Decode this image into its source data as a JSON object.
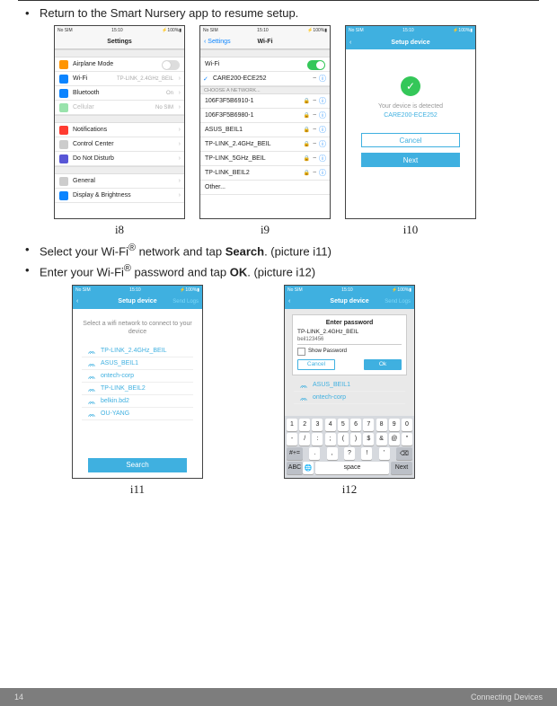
{
  "bullets": {
    "b1": "Return to the Smart Nursery app to resume setup.",
    "b2_pre": "Select your Wi-Fi",
    "b2_mid": " network and tap ",
    "b2_bold": "Search",
    "b2_post": ". (picture i11)",
    "b3_pre": "Enter your Wi-Fi",
    "b3_mid": " password and tap ",
    "b3_bold": "OK",
    "b3_post": ". (picture i12)",
    "reg": "®"
  },
  "captions": {
    "i8": "i8",
    "i9": "i9",
    "i10": "i10",
    "i11": "i11",
    "i12": "i12"
  },
  "status": {
    "left": "No SIM",
    "time": "15:10",
    "batt": "100%"
  },
  "i8": {
    "title": "Settings",
    "rows": {
      "airplane": "Airplane Mode",
      "wifi": "Wi-Fi",
      "wifi_val": "TP-LINK_2.4GHz_BEIL",
      "bt": "Bluetooth",
      "bt_val": "On",
      "cell": "Cellular",
      "cell_val": "No SIM",
      "notif": "Notifications",
      "cc": "Control Center",
      "dnd": "Do Not Disturb",
      "gen": "General",
      "disp": "Display & Brightness"
    }
  },
  "i9": {
    "back": "Settings",
    "title": "Wi-Fi",
    "wifi_label": "Wi-Fi",
    "connected": "CARE200-ECE252",
    "choose": "CHOOSE A NETWORK...",
    "n1": "106F3F5B6910-1",
    "n2": "106F3F5B6980-1",
    "n3": "ASUS_BEIL1",
    "n4": "TP-LINK_2.4GHz_BEIL",
    "n5": "TP-LINK_5GHz_BEIL",
    "n6": "TP-LINK_BEIL2",
    "other": "Other..."
  },
  "i10": {
    "title": "Setup device",
    "detected": "Your device is detected",
    "device": "CARE200-ECE252",
    "cancel": "Cancel",
    "next": "Next"
  },
  "i11": {
    "title": "Setup device",
    "send": "Send Logs",
    "prompt": "Select a wifi network to connect to your device",
    "n1": "TP-LINK_2.4GHz_BEIL",
    "n2": "ASUS_BEIL1",
    "n3": "ontech-corp",
    "n4": "TP-LINK_BEIL2",
    "n5": "belkin.bd2",
    "n6": "OU-YANG",
    "search": "Search"
  },
  "i12": {
    "title": "Setup device",
    "send": "Send Logs",
    "dialog_title": "Enter password",
    "ssid": "TP-LINK_2.4GHz_BEIL",
    "pw": "beil123456",
    "show": "Show Password",
    "cancel": "Cancel",
    "ok": "Ok",
    "behind1": "ASUS_BEIL1",
    "behind2": "ontech-corp",
    "keys_r1": [
      "1",
      "2",
      "3",
      "4",
      "5",
      "6",
      "7",
      "8",
      "9",
      "0"
    ],
    "keys_r2": [
      "-",
      "/",
      ":",
      ";",
      "(",
      ")",
      "$",
      "&",
      "@",
      "\""
    ],
    "keys_r3_mid": [
      ".",
      ",",
      "?",
      "!",
      "'"
    ],
    "space": "space",
    "next": "Next",
    "abc": "ABC",
    "sym": "#+="
  },
  "footer": {
    "page": "14",
    "section": "Connecting Devices"
  }
}
